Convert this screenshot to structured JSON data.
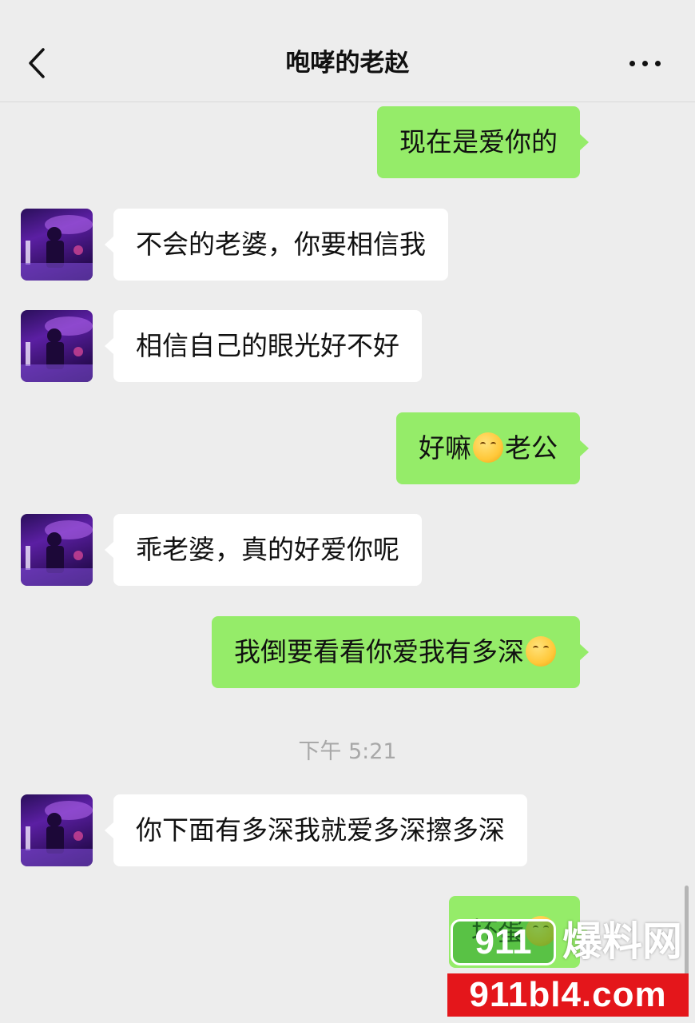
{
  "header": {
    "title": "咆哮的老赵",
    "back_icon": "chevron-left-icon",
    "more_icon": "more-dots-icon"
  },
  "messages": [
    {
      "side": "out",
      "text": "现在是爱你的"
    },
    {
      "side": "in",
      "text": "不会的老婆，你要相信我"
    },
    {
      "side": "in",
      "text": "相信自己的眼光好不好"
    },
    {
      "side": "out",
      "pre": "好嘛",
      "emoji": "blush-hand-emoji",
      "post": "老公"
    },
    {
      "side": "in",
      "text": "乖老婆，真的好爱你呢"
    },
    {
      "side": "out",
      "pre": "我倒要看看你爱我有多深",
      "emoji": "blush-hand-emoji"
    },
    {
      "side": "in",
      "text": "你下面有多深我就爱多深擦多深"
    },
    {
      "side": "out",
      "pre": "坏蛋",
      "emoji": "laughing-emoji"
    }
  ],
  "timestamp": "下午 5:21",
  "watermark": {
    "badge": "911",
    "title": "爆料网",
    "url": "911bl4.com"
  },
  "colors": {
    "background": "#ededed",
    "incoming_bubble": "#ffffff",
    "outgoing_bubble": "#95ec69",
    "timestamp": "#a8a8a8",
    "watermark_red": "#e4161b"
  }
}
